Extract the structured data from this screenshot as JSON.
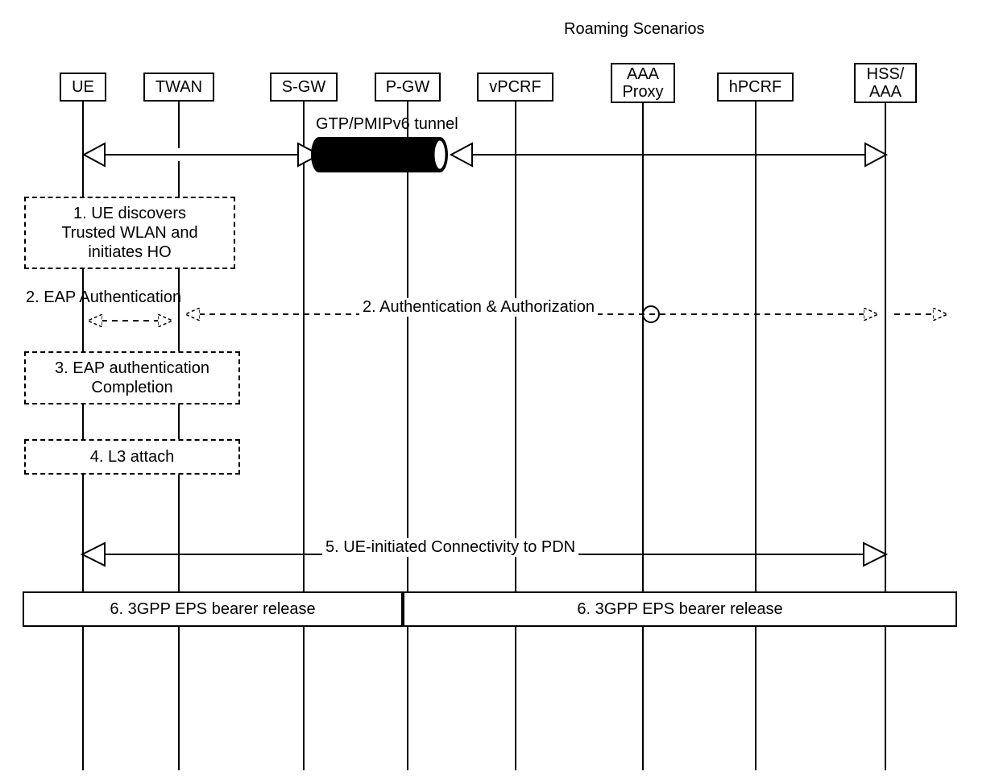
{
  "title": "Roaming  Scenarios",
  "lifelines": {
    "ue": "UE",
    "twan": "TWAN",
    "sgw": "S-GW",
    "pgw": "P-GW",
    "vpcrf": "vPCRF",
    "aaa_proxy": "AAA\nProxy",
    "hpcrf": "hPCRF",
    "hss_aaa": "HSS/\nAAA"
  },
  "tunnel_label": "GTP/PMIPv6 tunnel",
  "steps": {
    "s1": "1. UE discovers\nTrusted WLAN and\ninitiates HO",
    "s2a": "2. EAP Authentication",
    "s2b": "2. Authentication & Authorization",
    "s3": "3. EAP authentication\nCompletion",
    "s4": "4. L3 attach",
    "s5": "5. UE-initiated Connectivity to PDN",
    "s6a": "6. 3GPP EPS bearer release",
    "s6b": "6. 3GPP EPS bearer release"
  }
}
